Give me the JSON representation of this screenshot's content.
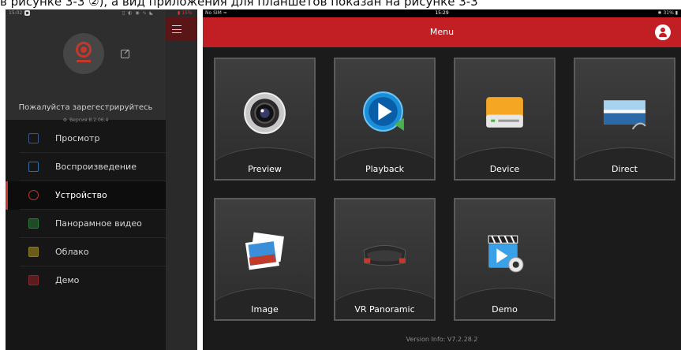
{
  "caption": {
    "text": "в рисунке 3-3 ②), а вид приложения для планшетов показан на рисунке 3-3"
  },
  "phone": {
    "status": {
      "time": "15:02",
      "icons": "▯ ◐ ◉ ∿ ◣",
      "battery": "▮ 15%"
    },
    "register_text": "Пожалуйста зарегестрируйтесь",
    "version": "Версия:8.2.06.4",
    "menu": [
      {
        "label": "Просмотр",
        "icon": "monitor-icon",
        "color": "#3a5a8a"
      },
      {
        "label": "Воспроизведение",
        "icon": "playback-icon",
        "color": "#2f6fa8"
      },
      {
        "label": "Устройство",
        "icon": "device-gear-icon",
        "color": "#c1392b"
      },
      {
        "label": "Панорамное видео",
        "icon": "panorama-icon",
        "color": "#2d7a3a"
      },
      {
        "label": "Облако",
        "icon": "cloud-icon",
        "color": "#8a7a20"
      },
      {
        "label": "Демо",
        "icon": "demo-icon",
        "color": "#8a2a2a"
      }
    ]
  },
  "tablet": {
    "status": {
      "carrier": "No SIM ≈",
      "time": "15:29",
      "battery": "✱ 31% ▮"
    },
    "title": "Menu",
    "tiles": [
      {
        "label": "Preview",
        "icon": "camera-lens-icon"
      },
      {
        "label": "Playback",
        "icon": "playback-globe-icon"
      },
      {
        "label": "Device",
        "icon": "hard-drive-icon"
      },
      {
        "label": "Direct",
        "icon": "direct-connection-icon"
      },
      {
        "label": "Image",
        "icon": "photo-stack-icon"
      },
      {
        "label": "VR Panoramic",
        "icon": "vr-headset-icon"
      },
      {
        "label": "Demo",
        "icon": "demo-clapper-icon"
      }
    ],
    "version_info": "Version Info: V7.2.28.2"
  }
}
